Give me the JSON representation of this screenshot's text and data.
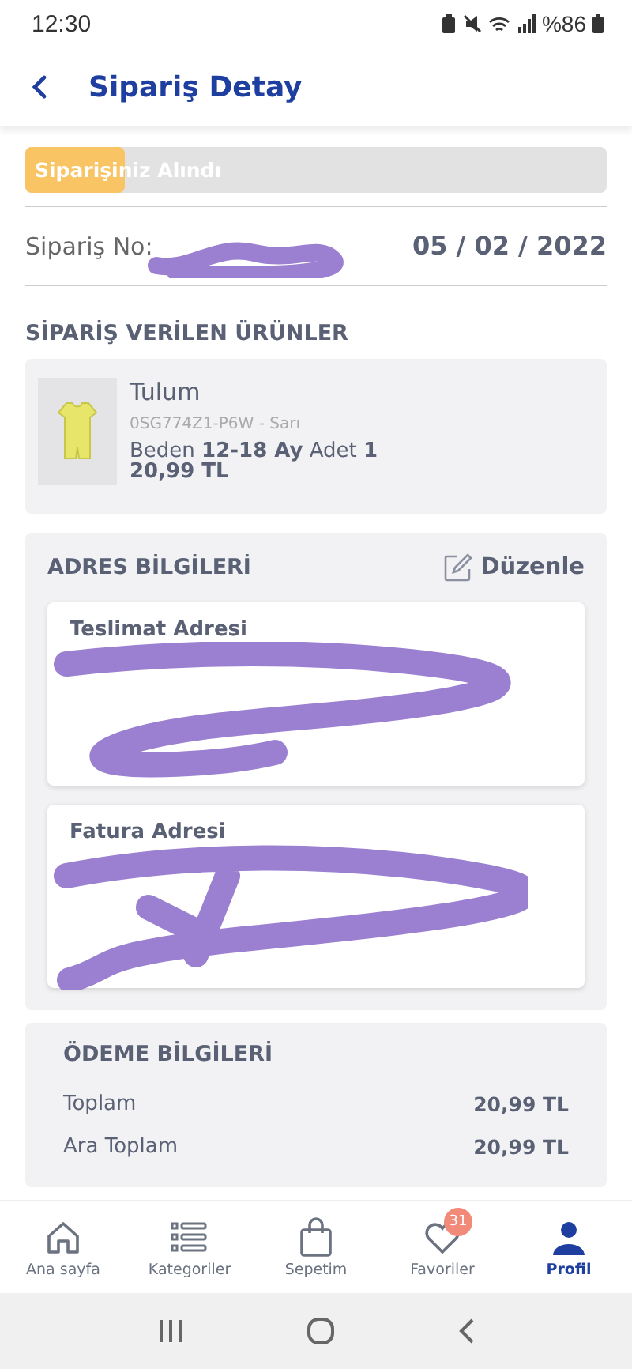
{
  "status_bar": {
    "time": "12:30",
    "battery": "%86"
  },
  "header": {
    "title": "Sipariş Detay"
  },
  "progress": {
    "label": "Siparişiniz Alındı",
    "level": 0.17
  },
  "order": {
    "number_label": "Sipariş No:",
    "date": "05 / 02 / 2022"
  },
  "products_title": "SİPARİŞ VERİLEN ÜRÜNLER",
  "products": [
    {
      "name": "Tulum",
      "code": "0SG774Z1-P6W - Sarı",
      "details": "Beden **12-18 Ay** Adet **1**",
      "price": "20,99 TL"
    }
  ],
  "address": {
    "title": "ADRES BİLGİLERİ",
    "edit": "Düzenle",
    "cards": [
      {
        "title": "Teslimat Adresi"
      },
      {
        "title": "Fatura Adresi"
      }
    ]
  },
  "payment": {
    "title": "ÖDEME BİLGİLERİ",
    "rows": [
      {
        "label": "Toplam",
        "value": "20,99 TL"
      },
      {
        "label": "Ara Toplam",
        "value": "20,99 TL"
      }
    ]
  },
  "nav": [
    {
      "kind": "home",
      "label": "Ana sayfa",
      "selected": false
    },
    {
      "kind": "list",
      "label": "Kategoriler",
      "selected": false
    },
    {
      "kind": "bag",
      "label": "Sepetim",
      "selected": false
    },
    {
      "kind": "heart",
      "label": "Favoriler",
      "selected": false,
      "badge": "31"
    },
    {
      "kind": "user",
      "label": "Profil",
      "selected": true
    }
  ]
}
